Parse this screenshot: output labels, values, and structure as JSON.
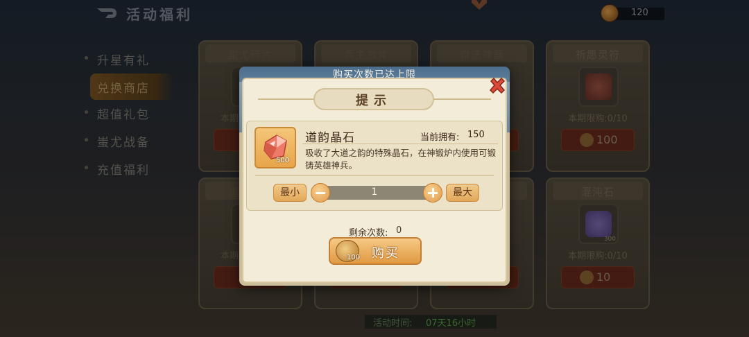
{
  "topbar": {
    "title": "活动福利",
    "currency_value": "120"
  },
  "side_menu": [
    {
      "label": "升星有礼"
    },
    {
      "label": "兑换商店"
    },
    {
      "label": "超值礼包"
    },
    {
      "label": "蚩尤战备"
    },
    {
      "label": "充值福利"
    }
  ],
  "cards": [
    {
      "title": "蚩尤碎片",
      "limit": "本期",
      "price": ""
    },
    {
      "title": "兵主战斧",
      "limit": "",
      "price": ""
    },
    {
      "title": "自选神器",
      "limit": "",
      "price": ""
    },
    {
      "title": "祈愿灵符",
      "limit": "本期限购:0/10",
      "price": "100"
    },
    {
      "title": "道",
      "limit": "本期",
      "price": ""
    },
    {
      "title": "混沌石",
      "limit": "本期限购:0/10",
      "price": "10",
      "count": "300"
    }
  ],
  "event_time": {
    "label": "活动时间:",
    "value": "07天16小时"
  },
  "modal": {
    "header": "购买次数已达上限",
    "title": "提示",
    "item_name": "道韵晶石",
    "item_qty": "500",
    "owned_label": "当前拥有:",
    "owned_value": "150",
    "description": "吸收了大道之韵的特殊晶石，在神锻炉内使用可锻铸英雄神兵。",
    "min_label": "最小",
    "max_label": "最大",
    "quantity": "1",
    "remaining_label": "剩余次数:",
    "remaining_value": "0",
    "buy_label": "购买",
    "buy_cost": "100"
  },
  "colors": {
    "accent_orange": "#e3a85a",
    "modal_header_blue": "#4c6d8c",
    "close_red": "#d94a3a",
    "panel_cream": "#f3ecd8"
  },
  "icons": [
    "back-arrow-icon",
    "currency-coin-icon",
    "close-icon",
    "crystal-gem-icon",
    "minus-icon",
    "plus-icon",
    "coin-icon"
  ]
}
